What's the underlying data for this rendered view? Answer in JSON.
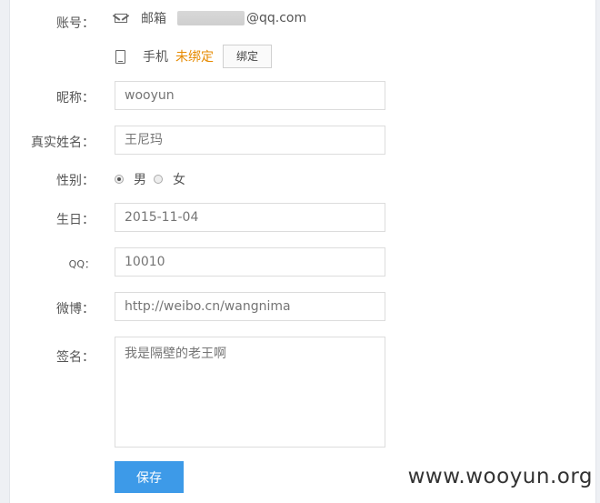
{
  "account": {
    "label": "账号：",
    "email_label": "邮箱",
    "email_suffix": "@qq.com",
    "phone_label": "手机",
    "phone_status": "未绑定",
    "bind_button": "绑定"
  },
  "nickname": {
    "label": "昵称：",
    "placeholder": "wooyun"
  },
  "realname": {
    "label": "真实姓名：",
    "placeholder": "王尼玛"
  },
  "gender": {
    "label": "性别：",
    "options": [
      "男",
      "女"
    ],
    "selected": "男"
  },
  "birthday": {
    "label": "生日：",
    "placeholder": "2015-11-04"
  },
  "qq": {
    "label": "QQ：",
    "placeholder": "10010"
  },
  "weibo": {
    "label": "微博：",
    "placeholder": "http://weibo.cn/wangnima"
  },
  "signature": {
    "label": "签名：",
    "placeholder": "我是隔壁的老王啊"
  },
  "save_button": "保存",
  "watermark": "www.wooyun.org"
}
